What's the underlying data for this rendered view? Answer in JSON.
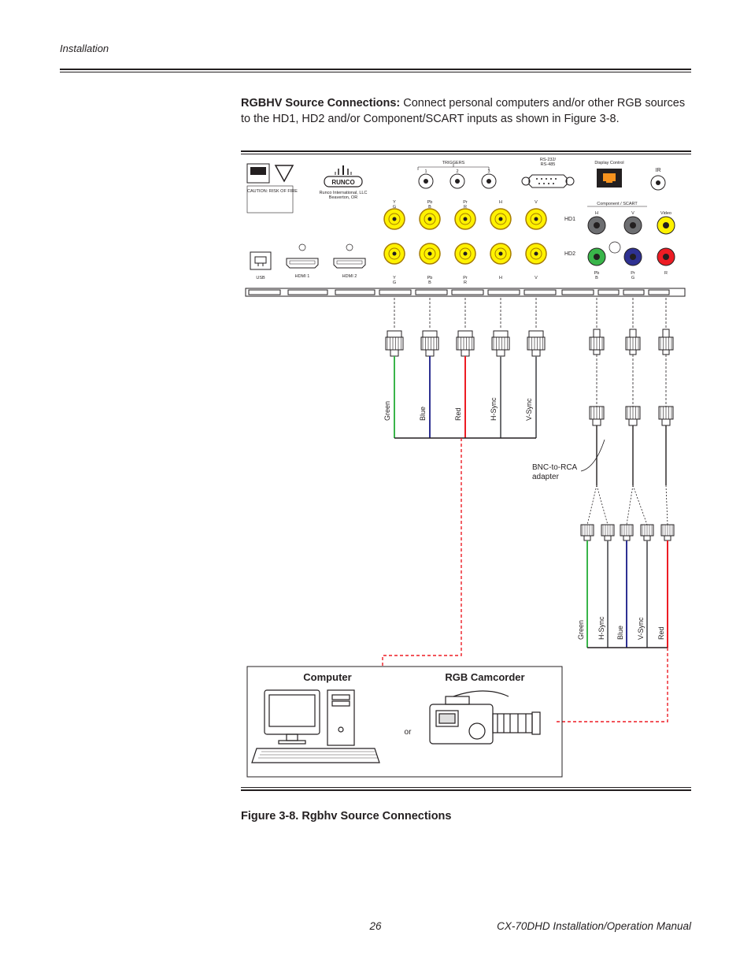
{
  "header": {
    "section": "Installation"
  },
  "para": {
    "lead": "RGBHV Source Connections:",
    "rest": " Connect personal computers and/or other RGB sources to the HD1, HD2 and/or Component/SCART inputs as shown in Figure 3-8."
  },
  "figure": {
    "caption": "Figure 3-8. Rgbhv Source Connections",
    "panel": {
      "brand": "RUNCO",
      "brand_sub1": "Runco International, LLC",
      "brand_sub2": "Beaverton, OR",
      "triggers": "TRIGGERS",
      "trig": [
        "1",
        "2",
        "3"
      ],
      "rs": "RS-232/\nRS-485",
      "disp": "Display Control",
      "ir": "IR",
      "scart": "Component / SCART",
      "video": "Video",
      "hd1": "HD1",
      "hd2": "HD2",
      "hv": [
        "H",
        "V"
      ],
      "row_hd1": [
        "Y",
        "Pb",
        "Pr",
        "H",
        "V"
      ],
      "row_hd1b": [
        "G",
        "B",
        "R",
        "",
        ""
      ],
      "row_hd2": [
        "Y",
        "Pb",
        "Pr",
        "H",
        "V"
      ],
      "row_hd2b": [
        "G",
        "B",
        "R",
        "",
        ""
      ],
      "pbpr": "Pb\nPr",
      "usb": "USB",
      "hdmi": [
        "HDMI 1",
        "HDMI 2"
      ]
    },
    "cables_left": [
      "Green",
      "Blue",
      "Red",
      "H-Sync",
      "V-Sync"
    ],
    "cables_right": [
      "Green",
      "H-Sync",
      "Blue",
      "V-Sync",
      "Red"
    ],
    "bnc_note": "BNC-to-RCA\nadapter",
    "devices": {
      "computer": "Computer",
      "or": "or",
      "cam": "RGB Camcorder"
    }
  },
  "footer": {
    "page": "26",
    "doc": "CX-70DHD Installation/Operation Manual"
  }
}
